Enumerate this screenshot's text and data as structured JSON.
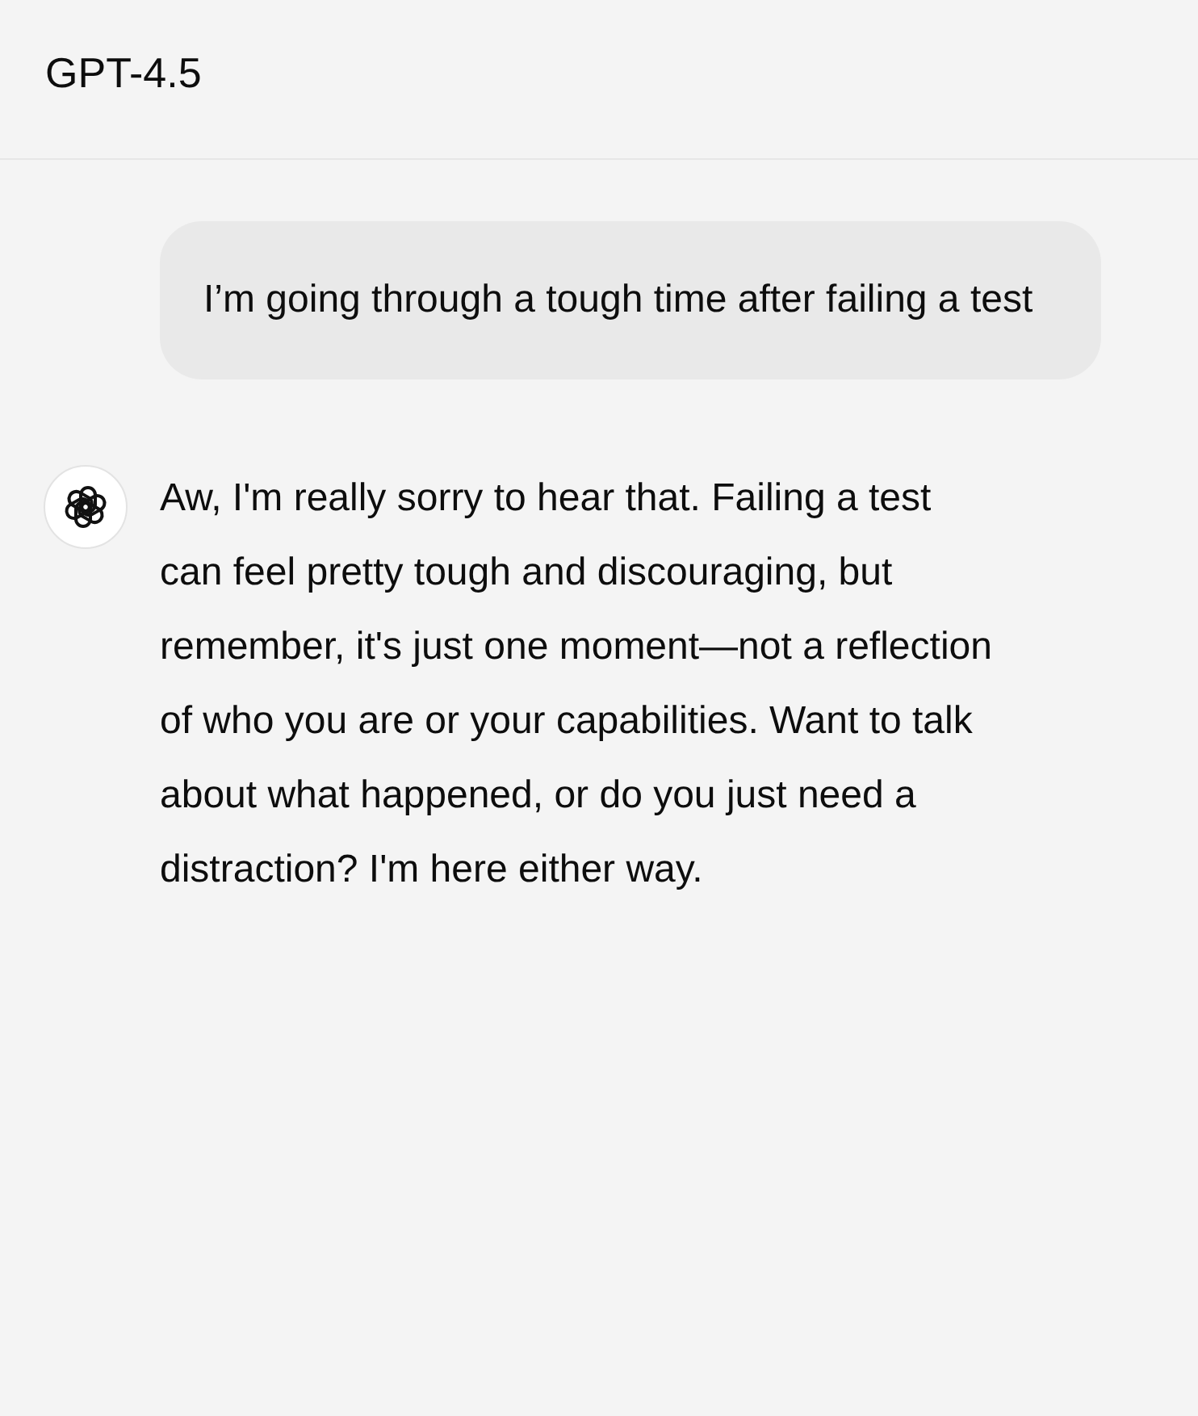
{
  "header": {
    "title": "GPT-4.5"
  },
  "messages": [
    {
      "kind": "user",
      "text": "I’m going through a tough time after failing a test"
    },
    {
      "kind": "assistant",
      "text": "Aw, I'm really sorry to hear that. Failing a test can feel pretty tough and discouraging, but remember, it's just one moment—not a reflection of who you are or your capabilities. Want to talk about what happened, or do you just need a distraction? I'm here either way."
    }
  ]
}
